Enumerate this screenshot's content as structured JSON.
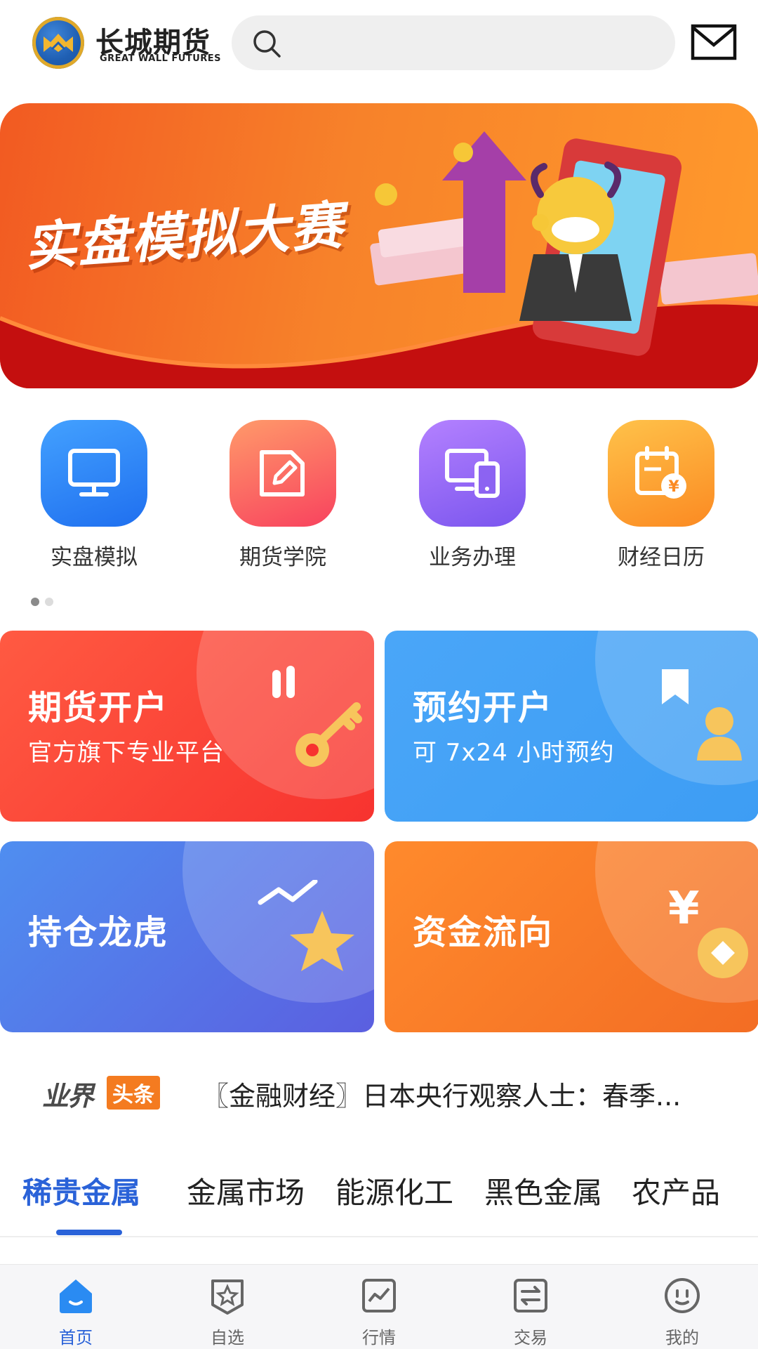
{
  "header": {
    "brand_cn": "长城期货",
    "brand_en": "GREAT WALL FUTURES",
    "search_placeholder": ""
  },
  "banner": {
    "title": "实盘模拟大赛"
  },
  "quick_links": [
    {
      "label": "实盘模拟",
      "icon": "monitor-icon",
      "color": "#2f86f6"
    },
    {
      "label": "期货学院",
      "icon": "edit-note-icon",
      "color": "#fb5a5f"
    },
    {
      "label": "业务办理",
      "icon": "devices-icon",
      "color": "#8c63f2"
    },
    {
      "label": "财经日历",
      "icon": "calendar-yen-icon",
      "color": "#fda034"
    }
  ],
  "pager": {
    "pages": 2,
    "active": 1
  },
  "cards": [
    {
      "title": "期货开户",
      "subtitle": "官方旗下专业平台",
      "icon": "key-icon",
      "color": "#f73b3b"
    },
    {
      "title": "预约开户",
      "subtitle": "可 7x24 小时预约",
      "icon": "person-icon",
      "color": "#3fa4f5"
    },
    {
      "title": "持仓龙虎",
      "subtitle": "",
      "icon": "star-icon",
      "color": "#5a6fe6"
    },
    {
      "title": "资金流向",
      "subtitle": "",
      "icon": "coin-yen-icon",
      "color": "#f77a24"
    }
  ],
  "news": {
    "logo_a": "业界",
    "logo_b": "头条",
    "headline": "〖金融财经〗日本央行观察人士：春季..."
  },
  "category_tabs": [
    "稀贵金属",
    "金属市场",
    "能源化工",
    "黑色金属",
    "农产品"
  ],
  "active_tab": "稀贵金属",
  "bottom_nav": [
    {
      "label": "首页",
      "icon": "home-icon",
      "active": true
    },
    {
      "label": "自选",
      "icon": "star-badge-icon",
      "active": false
    },
    {
      "label": "行情",
      "icon": "chart-icon",
      "active": false
    },
    {
      "label": "交易",
      "icon": "exchange-icon",
      "active": false
    },
    {
      "label": "我的",
      "icon": "profile-icon",
      "active": false
    }
  ],
  "colors": {
    "accent": "#2a62d8",
    "nav_bg": "#f6f6f8"
  }
}
